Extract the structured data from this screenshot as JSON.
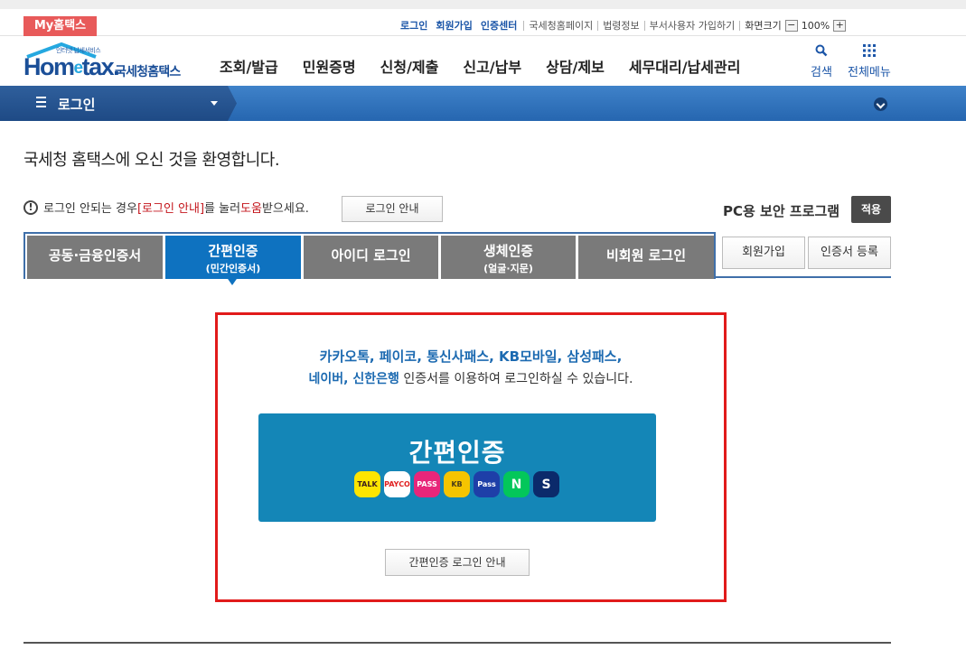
{
  "util": {
    "my_hometax": "My홈택스",
    "links_blue": [
      "로그인",
      "회원가입",
      "인증센터"
    ],
    "links": [
      "국세청홈페이지",
      "법령정보",
      "부서사용자 가입하기",
      "화면크기"
    ],
    "zoom_minus": "−",
    "zoom_value": "100%",
    "zoom_plus": "+"
  },
  "header": {
    "logo_tagline": "인터넷 납세서비스",
    "logo_word_a": "Hom",
    "logo_word_e": "e",
    "logo_word_b": "tax.",
    "logo_korean": "국세청홈택스",
    "menu": [
      "조회/발급",
      "민원증명",
      "신청/제출",
      "신고/납부",
      "상담/제보",
      "세무대리/납세관리"
    ],
    "search_label": "검색",
    "allmenu_label": "전체메뉴"
  },
  "nav": {
    "current": "로그인"
  },
  "main": {
    "welcome": "국세청 홈택스에 오신 것을 환영합니다.",
    "help_pre": "로그인 안되는 경우 ",
    "help_link": "[로그인 안내]",
    "help_mid": "를 눌러 ",
    "help_red": "도움",
    "help_post": "받으세요.",
    "help_button": "로그인 안내",
    "pc_security": "PC용 보안 프로그램",
    "apply_button": "적용"
  },
  "tabs": [
    {
      "label": "공동·금융인증서",
      "sub": ""
    },
    {
      "label": "간편인증",
      "sub": "(민간인증서)"
    },
    {
      "label": "아이디 로그인",
      "sub": ""
    },
    {
      "label": "생체인증",
      "sub": "(얼굴·지문)"
    },
    {
      "label": "비회원 로그인",
      "sub": ""
    }
  ],
  "side_buttons": {
    "join": "회원가입",
    "cert_register": "인증서 등록"
  },
  "simple_auth": {
    "desc_line1": "카카오톡, 페이코, 통신사패스, KB모바일, 삼성패스,",
    "desc_line2_blue": "네이버, 신한은행",
    "desc_line2_rest": " 인증서를 이용하여 로그인하실 수 있습니다.",
    "button_title": "간편인증",
    "providers": [
      {
        "name": "kakao-talk-icon",
        "text": "TALK",
        "bg": "#fee500",
        "fg": "#3a1d1d"
      },
      {
        "name": "payco-icon",
        "text": "PAYCO",
        "bg": "#ffffff",
        "fg": "#e02020"
      },
      {
        "name": "pass-icon",
        "text": "PASS",
        "bg": "#e8267a",
        "fg": "#ffffff"
      },
      {
        "name": "kb-mobile-icon",
        "text": "KB",
        "bg": "#f5c400",
        "fg": "#4a3d1a"
      },
      {
        "name": "samsung-pass-icon",
        "text": "Pass",
        "bg": "#1e3fa8",
        "fg": "#ffffff"
      },
      {
        "name": "naver-icon",
        "text": "N",
        "bg": "#03c75a",
        "fg": "#ffffff"
      },
      {
        "name": "shinhan-icon",
        "text": "S",
        "bg": "#0b2a6b",
        "fg": "#ffffff"
      }
    ],
    "guide_button": "간편인증 로그인 안내"
  }
}
